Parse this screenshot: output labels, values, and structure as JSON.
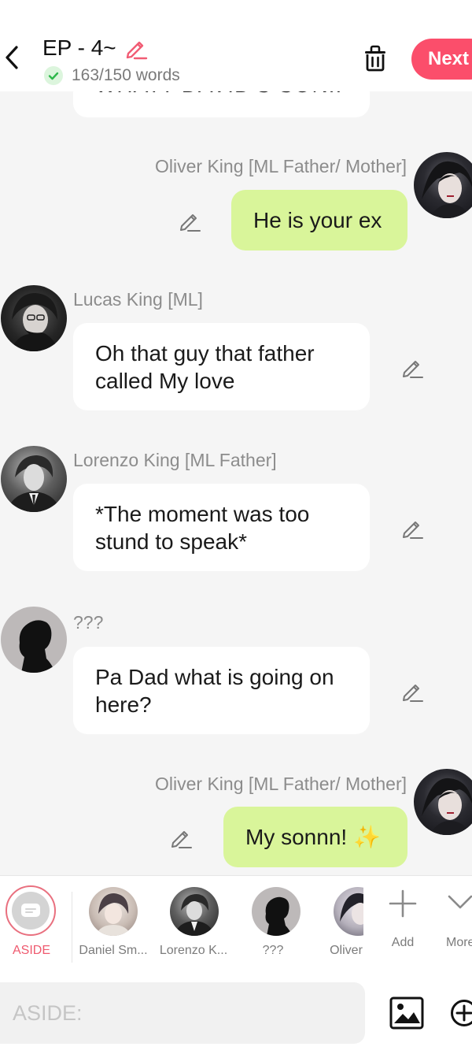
{
  "header": {
    "back_label": "Back",
    "episode_title": "EP - 4~",
    "word_count": "163/150 words",
    "next_label": "Next"
  },
  "messages": [
    {
      "speaker": "",
      "text": "WHAT? DAVID'S SON..",
      "side": "left"
    },
    {
      "speaker": "Oliver King [ML Father/ Mother]",
      "text": "He is your ex",
      "side": "right"
    },
    {
      "speaker": "Lucas King [ML]",
      "text": "Oh that guy that father called My love",
      "side": "left"
    },
    {
      "speaker": "Lorenzo King [ML Father]",
      "text": "*The moment was too stund to speak*",
      "side": "left"
    },
    {
      "speaker": "???",
      "text": "Pa Dad what is going on here?",
      "side": "left"
    },
    {
      "speaker": "Oliver King [ML Father/ Mother]",
      "text": "My sonnn! ✨",
      "side": "right"
    }
  ],
  "characters": [
    {
      "label": "ASIDE",
      "active": true
    },
    {
      "label": "Daniel Sm..."
    },
    {
      "label": "Lorenzo K..."
    },
    {
      "label": "???"
    },
    {
      "label": "Oliver"
    },
    {
      "label": "Add"
    },
    {
      "label": "More"
    }
  ],
  "input": {
    "placeholder": "ASIDE:"
  },
  "colors": {
    "accent": "#fb4e6b",
    "my_bubble": "#d9f59a",
    "other_bubble": "#ffffff",
    "background": "#f5f5f5",
    "aside_ring": "#e9707f"
  },
  "icons": [
    "chevron-left-icon",
    "pencil-icon",
    "check-circle-icon",
    "trash-icon",
    "image-icon",
    "plus-circle-icon",
    "plus-icon",
    "chevron-down-icon"
  ]
}
